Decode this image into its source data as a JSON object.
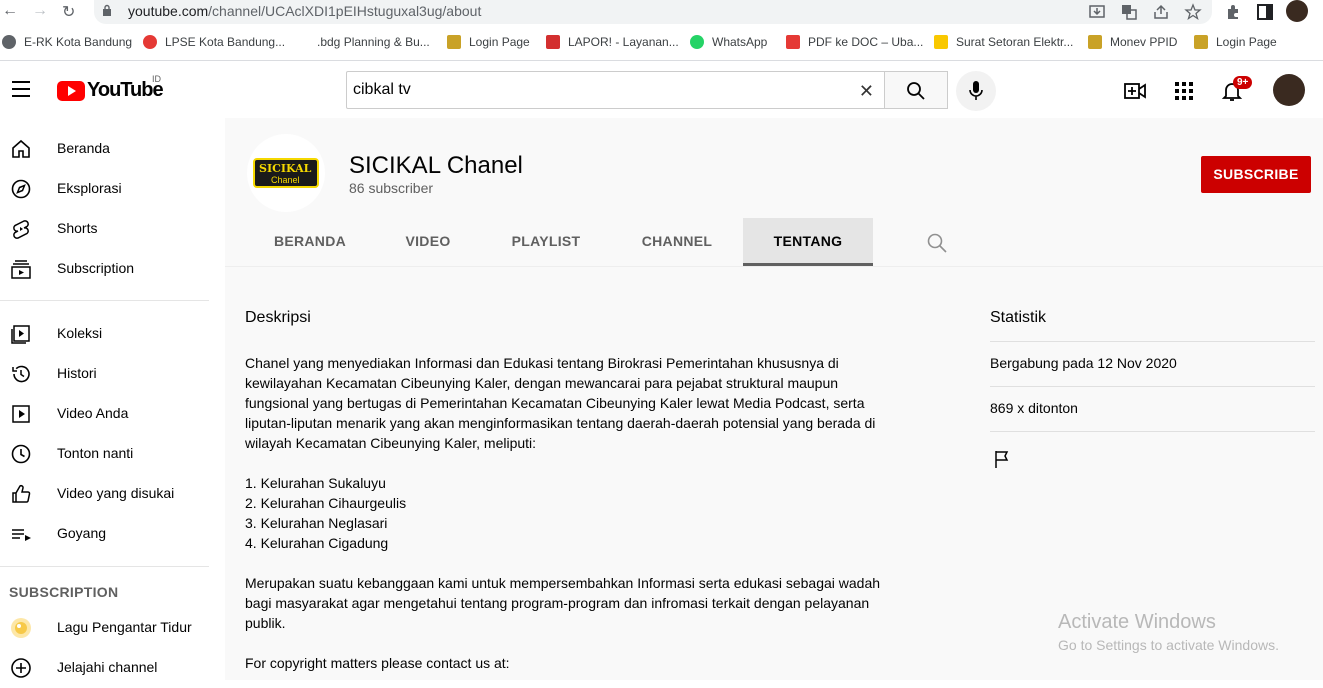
{
  "browser": {
    "url_host": "youtube.com",
    "url_path": "/channel/UCAclXDI1pEIHstuguxal3ug/about",
    "bookmarks": [
      {
        "label": "E-RK Kota Bandung",
        "color": "#5f6368"
      },
      {
        "label": "LPSE Kota Bandung...",
        "color": "#e53935"
      },
      {
        "label": ".bdg Planning & Bu...",
        "color": "#ffffff"
      },
      {
        "label": "Login Page",
        "color": "#c9a227"
      },
      {
        "label": "LAPOR! - Layanan...",
        "color": "#d32f2f"
      },
      {
        "label": "WhatsApp",
        "color": "#25d366"
      },
      {
        "label": "PDF ke DOC – Uba...",
        "color": "#e53935"
      },
      {
        "label": "Surat Setoran Elektr...",
        "color": "#f9c800"
      },
      {
        "label": "Monev PPID",
        "color": "#c9a227"
      },
      {
        "label": "Login Page",
        "color": "#c9a227"
      }
    ]
  },
  "header": {
    "logo_text": "YouTube",
    "country_code": "ID",
    "search_value": "cibkal tv",
    "notification_badge": "9+"
  },
  "sidebar": {
    "primary": [
      {
        "label": "Beranda",
        "icon": "home-icon"
      },
      {
        "label": "Eksplorasi",
        "icon": "compass-icon"
      },
      {
        "label": "Shorts",
        "icon": "shorts-icon"
      },
      {
        "label": "Subscription",
        "icon": "subscriptions-icon"
      }
    ],
    "library": [
      {
        "label": "Koleksi",
        "icon": "library-icon"
      },
      {
        "label": "Histori",
        "icon": "history-icon"
      },
      {
        "label": "Video Anda",
        "icon": "your-videos-icon"
      },
      {
        "label": "Tonton nanti",
        "icon": "watch-later-icon"
      },
      {
        "label": "Video yang disukai",
        "icon": "like-icon"
      },
      {
        "label": "Goyang",
        "icon": "playlist-icon"
      }
    ],
    "subscription_heading": "SUBSCRIPTION",
    "subscriptions": [
      {
        "label": "Lagu Pengantar Tidur",
        "icon": "channel-avatar-icon"
      },
      {
        "label": "Jelajahi channel",
        "icon": "add-circle-icon"
      }
    ]
  },
  "channel": {
    "logo_line1": "SICIKAL",
    "logo_line2": "Chanel",
    "name": "SICIKAL Chanel",
    "subscribers": "86 subscriber",
    "subscribe_label": "SUBSCRIBE",
    "tabs": [
      "BERANDA",
      "VIDEO",
      "PLAYLIST",
      "CHANNEL",
      "TENTANG"
    ],
    "active_tab": "TENTANG"
  },
  "about": {
    "description_title": "Deskripsi",
    "description": "Chanel yang menyediakan Informasi dan Edukasi tentang Birokrasi Pemerintahan khususnya di kewilayahan Kecamatan Cibeunying Kaler, dengan mewancarai para pejabat struktural maupun fungsional yang bertugas di Pemerintahan Kecamatan Cibeunying Kaler lewat Media Podcast, serta liputan-liputan menarik yang akan menginformasikan tentang daerah-daerah potensial yang berada di wilayah Kecamatan Cibeunying Kaler, meliputi:\n\n1. Kelurahan Sukaluyu\n2. Kelurahan Cihaurgeulis\n3. Kelurahan Neglasari\n4. Kelurahan Cigadung\n\nMerupakan suatu kebanggaan kami untuk mempersembahkan Informasi serta edukasi sebagai wadah bagi masyarakat agar mengetahui tentang program-program dan infromasi terkait dengan pelayanan publik.\n\nFor copyright matters please contact us at:",
    "stats_title": "Statistik",
    "joined": "Bergabung pada 12 Nov 2020",
    "views": "869 x ditonton"
  },
  "watermark": {
    "line1": "Activate Windows",
    "line2": "Go to Settings to activate Windows."
  }
}
